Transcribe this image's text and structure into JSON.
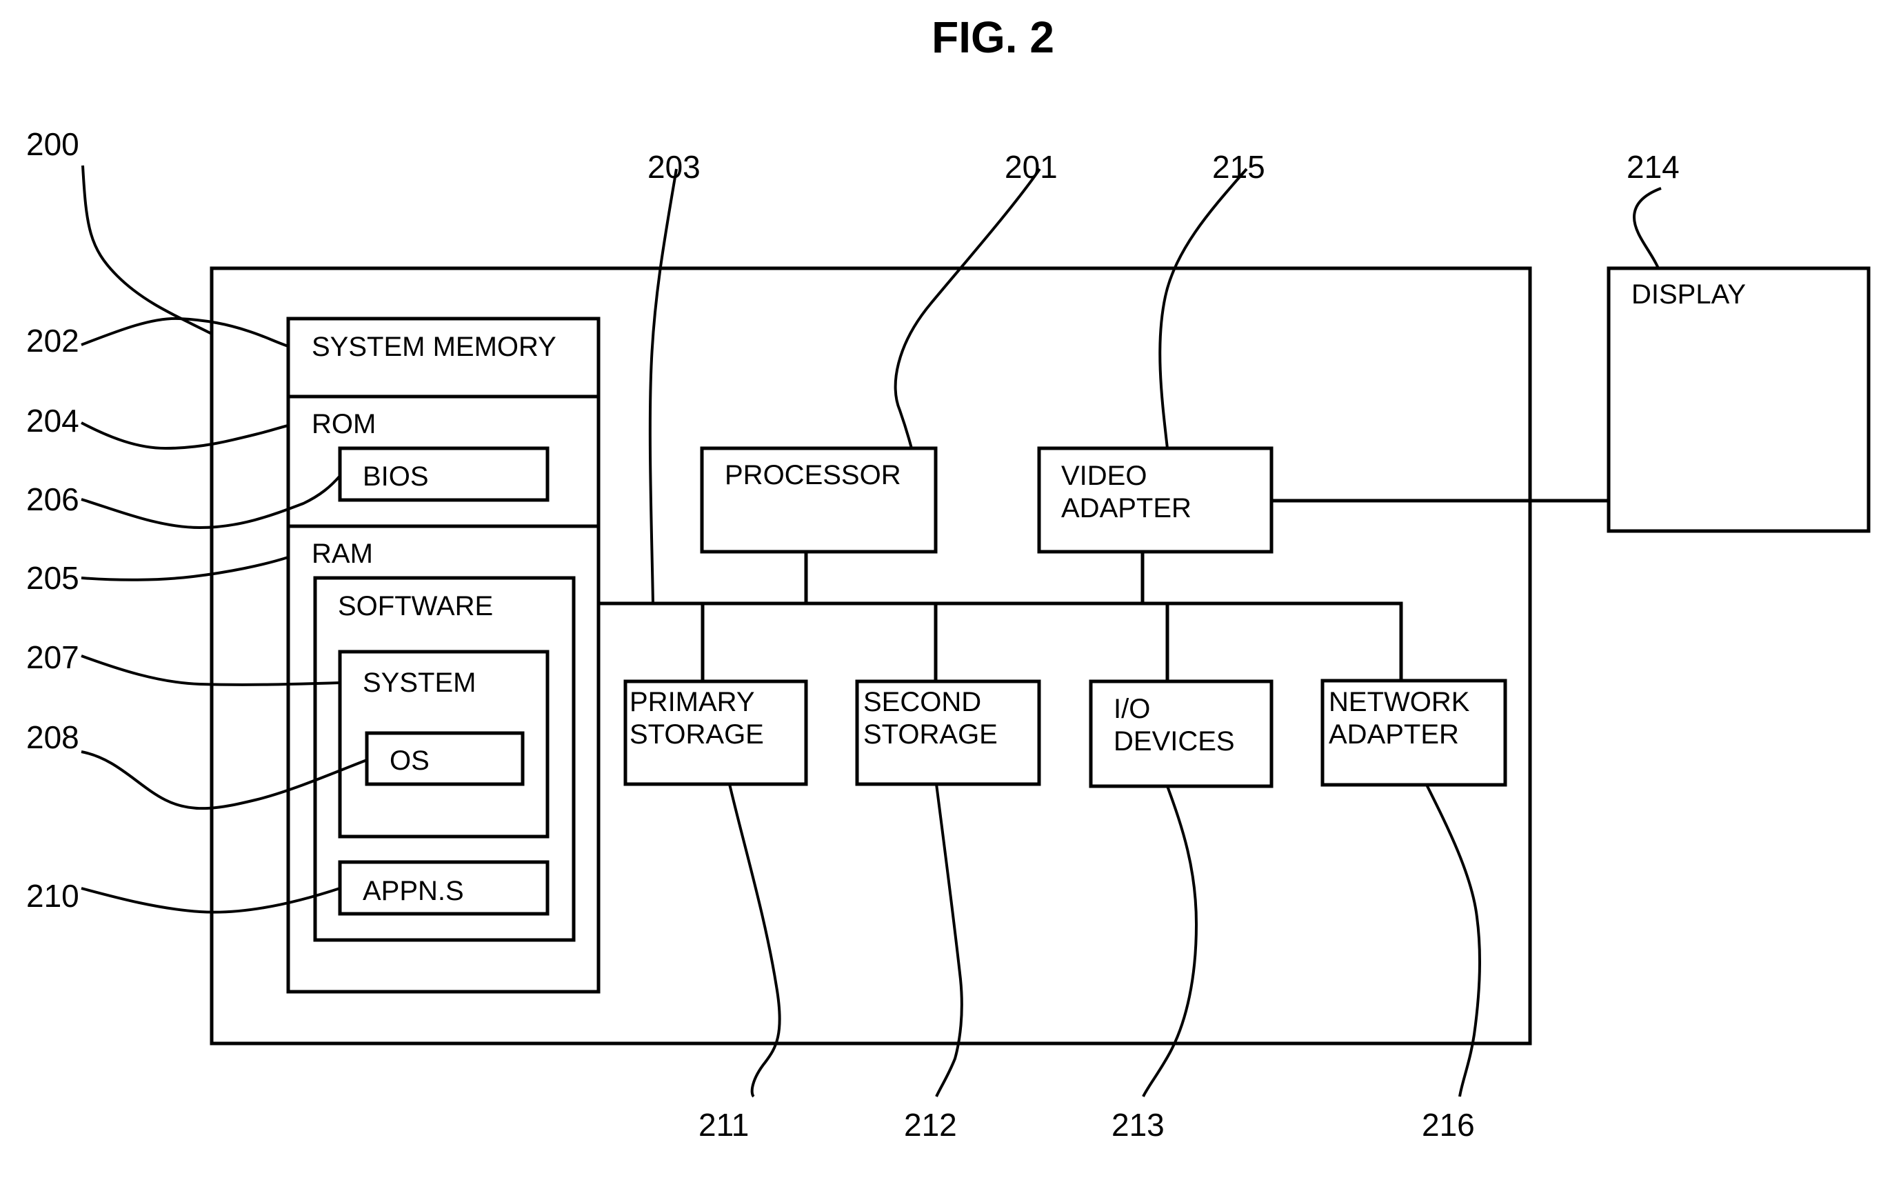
{
  "figure": {
    "title": "FIG. 2",
    "stroke_color": "#000000",
    "background_color": "#ffffff"
  },
  "components": {
    "system_memory": {
      "label": "SYSTEM MEMORY",
      "ref": "202"
    },
    "rom": {
      "label": "ROM",
      "ref": "204"
    },
    "bios": {
      "label": "BIOS",
      "ref": "206"
    },
    "ram": {
      "label": "RAM",
      "ref": "205"
    },
    "software": {
      "label": "SOFTWARE"
    },
    "system": {
      "label": "SYSTEM",
      "ref": "207"
    },
    "os": {
      "label": "OS",
      "ref": "208"
    },
    "applications": {
      "label": "APPN.S",
      "ref": "210"
    },
    "processor": {
      "label": "PROCESSOR",
      "ref": "201"
    },
    "video_adapter": {
      "line1": "VIDEO",
      "line2": "ADAPTER",
      "ref": "215"
    },
    "display": {
      "label": "DISPLAY",
      "ref": "214"
    },
    "primary_storage": {
      "line1": "PRIMARY",
      "line2": "STORAGE",
      "ref": "211"
    },
    "second_storage": {
      "line1": "SECOND",
      "line2": "STORAGE",
      "ref": "212"
    },
    "io_devices": {
      "line1": "I/O",
      "line2": "DEVICES",
      "ref": "213"
    },
    "network_adapter": {
      "line1": "NETWORK",
      "line2": "ADAPTER",
      "ref": "216"
    },
    "computer_system": {
      "ref": "200"
    },
    "bus": {
      "ref": "203"
    }
  }
}
